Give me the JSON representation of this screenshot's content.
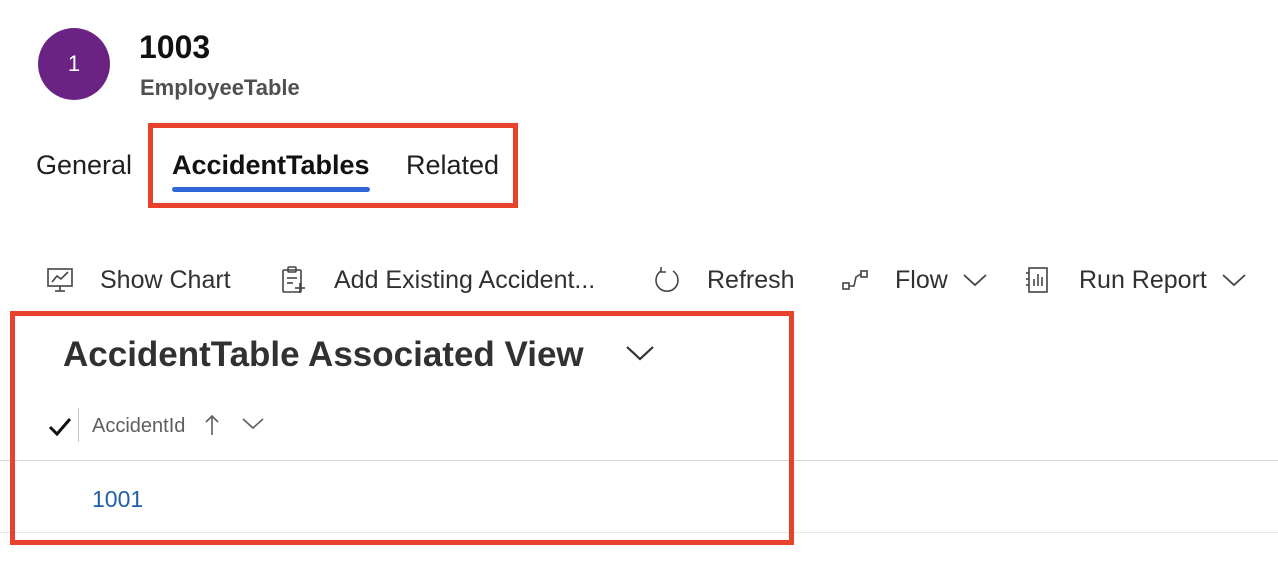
{
  "header": {
    "avatar_initial": "1",
    "avatar_color": "#6b2383",
    "title": "1003",
    "subtitle": "EmployeeTable"
  },
  "tabs": [
    {
      "label": "General",
      "selected": false
    },
    {
      "label": "AccidentTables",
      "selected": true
    },
    {
      "label": "Related",
      "selected": false
    }
  ],
  "commands": {
    "show_chart": {
      "label": "Show Chart",
      "icon": "chart-icon"
    },
    "add_existing": {
      "label": "Add Existing Accident...",
      "icon": "clipboard-add-icon"
    },
    "refresh": {
      "label": "Refresh",
      "icon": "refresh-icon"
    },
    "flow": {
      "label": "Flow",
      "icon": "flow-icon"
    },
    "run_report": {
      "label": "Run Report",
      "icon": "report-icon"
    }
  },
  "view": {
    "title": "AccidentTable Associated View",
    "column_header": "AccidentId",
    "sort": "ascending",
    "rows": [
      {
        "accident_id": "1001"
      }
    ]
  },
  "colors": {
    "accent": "#2f66d6",
    "highlight": "#e8412c",
    "link": "#1f5fa8"
  }
}
